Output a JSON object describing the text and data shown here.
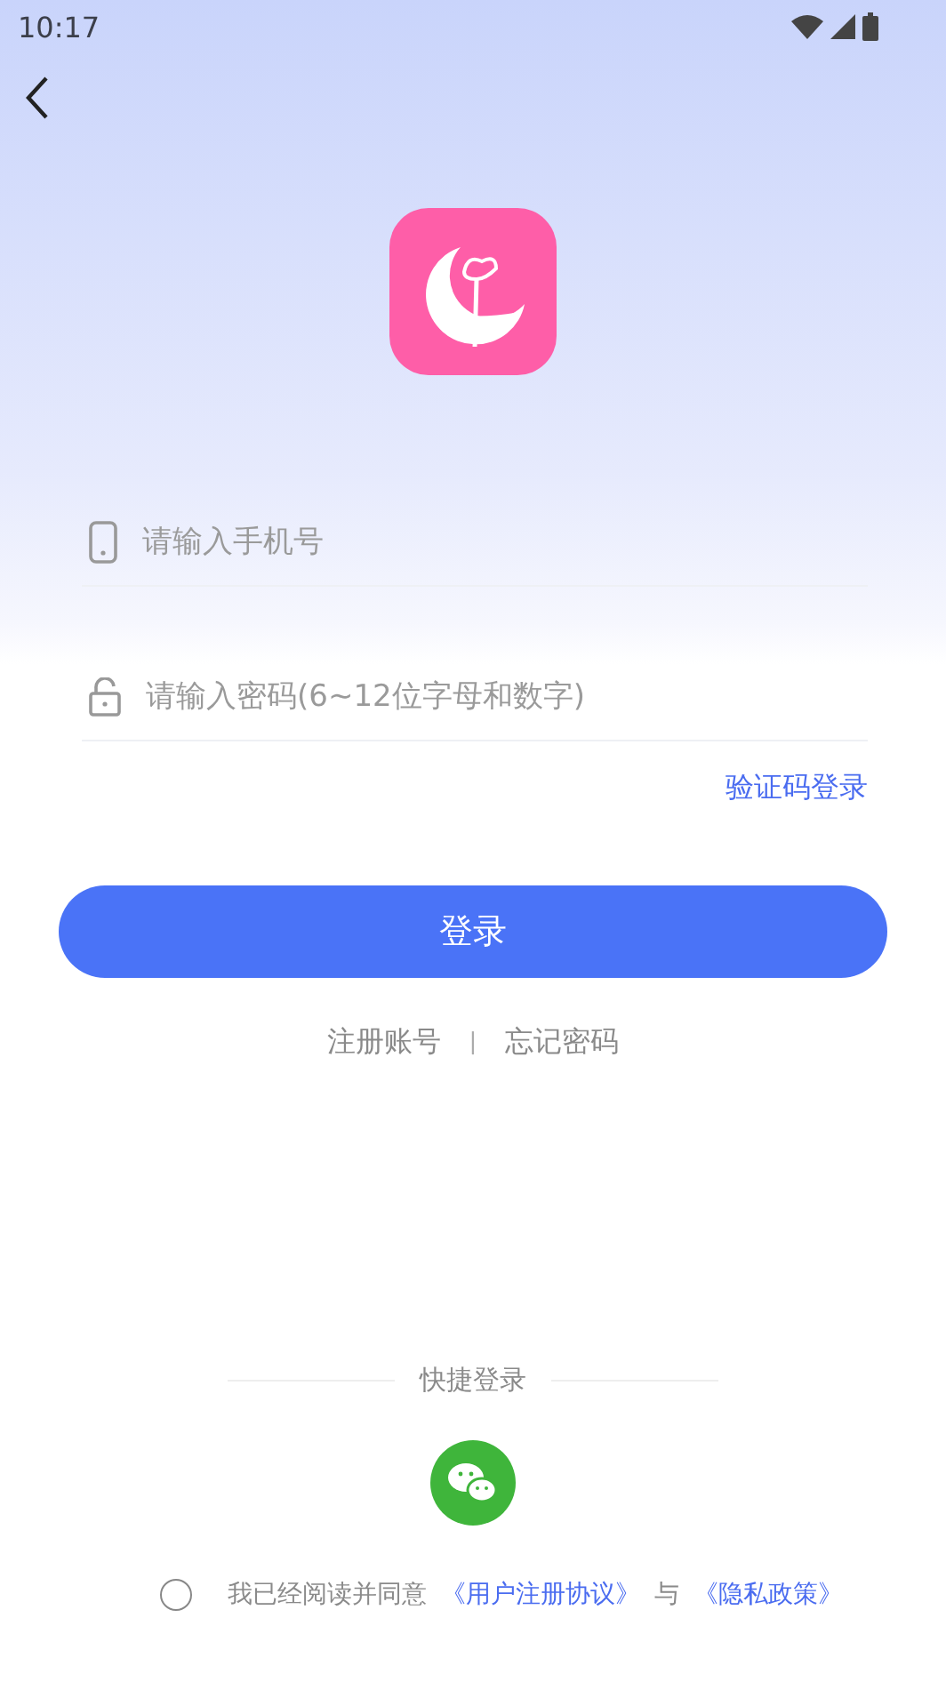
{
  "status_bar": {
    "time": "10:17"
  },
  "phone_field": {
    "placeholder": "请输入手机号"
  },
  "password_field": {
    "placeholder": "请输入密码(6~12位字母和数字)"
  },
  "code_login_link": "验证码登录",
  "login_button": "登录",
  "links": [
    "注册账号",
    "忘记密码"
  ],
  "links_separator": "|",
  "quick_login": {
    "title": "快捷登录"
  },
  "agreement": {
    "checked": false,
    "text": "我已经阅读并同意",
    "terms_link": "《用户注册协议》",
    "conjunction": "与",
    "privacy_link": "《隐私政策》"
  }
}
